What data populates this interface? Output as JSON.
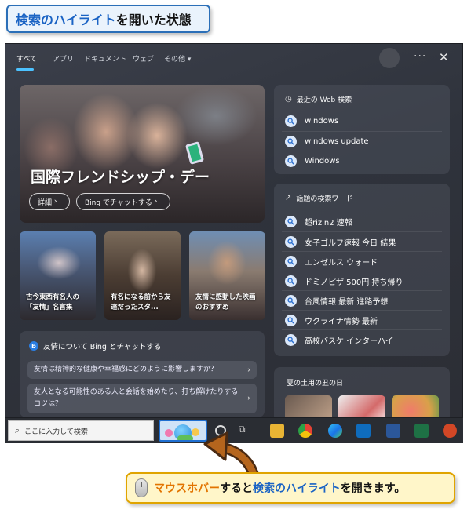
{
  "callout_title": {
    "part1": "検索のハイライト",
    "part2": "を開いた状態"
  },
  "nav": {
    "tabs": [
      {
        "label": "すべて",
        "active": true
      },
      {
        "label": "アプリ"
      },
      {
        "label": "ドキュメント"
      },
      {
        "label": "ウェブ"
      },
      {
        "label": "その他"
      }
    ],
    "more": "···",
    "close": "✕"
  },
  "hero": {
    "title": "国際フレンドシップ・デー",
    "btn_details": "詳細",
    "btn_chat": "Bing でチャットする"
  },
  "thumbs": [
    {
      "caption": "古今東西有名人の「友情」名言集"
    },
    {
      "caption": "有名になる前から友達だったスタ..."
    },
    {
      "caption": "友情に感動した映画のおすすめ"
    }
  ],
  "chat": {
    "title": "友情について Bing とチャットする",
    "questions": [
      "友情は精神的な健康や幸福感にどのように影響しますか？",
      "友人となる可能性のある人と会話を始めたり、打ち解けたりするコツは？"
    ]
  },
  "recent": {
    "title": "最近の Web 検索",
    "items": [
      "windows",
      "windows update",
      "Windows"
    ]
  },
  "trending": {
    "title": "話題の検索ワード",
    "items": [
      "超rizin2 速報",
      "女子ゴルフ速報 今日 結果",
      "エンゼルス ウォード",
      "ドミノピザ 500円 持ち帰り",
      "台風情報 最新 進路予想",
      "ウクライナ情勢 最新",
      "高校バスケ インターハイ"
    ]
  },
  "summer": {
    "title": "夏の土用の丑の日"
  },
  "taskbar": {
    "search_placeholder": "ここに入力して検索"
  },
  "bottom_callout": {
    "p1": "マウスホバー",
    "p2": "すると",
    "p3": "検索のハイライト",
    "p4": "を開きます。"
  },
  "colors": {
    "accent": "#4cc2ff",
    "callout_blue": "#1a63c4",
    "callout_orange": "#e27400"
  }
}
